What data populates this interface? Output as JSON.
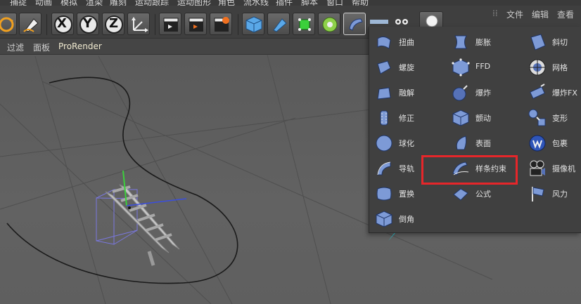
{
  "menubar": {
    "items": [
      "捕捉",
      "动画",
      "模拟",
      "渲染",
      "雕刻",
      "运动跟踪",
      "运动图形",
      "角色",
      "流水线",
      "插件",
      "脚本",
      "窗口",
      "帮助"
    ]
  },
  "toolbar": {
    "axis_x": "X",
    "axis_y": "Y",
    "axis_z": "Z"
  },
  "secondary_bar": {
    "items": [
      "过滤",
      "面板",
      "ProRender"
    ]
  },
  "right_panel": {
    "tabs": [
      "文件",
      "编辑",
      "查看"
    ]
  },
  "deformer_menu": {
    "columns": [
      [
        {
          "label": "扭曲",
          "icon": "twist-icon"
        },
        {
          "label": "螺旋",
          "icon": "helix-icon"
        },
        {
          "label": "融解",
          "icon": "melt-icon"
        },
        {
          "label": "修正",
          "icon": "correction-icon"
        },
        {
          "label": "球化",
          "icon": "spherify-icon"
        },
        {
          "label": "导轨",
          "icon": "rail-icon"
        },
        {
          "label": "置换",
          "icon": "displace-icon"
        },
        {
          "label": "倒角",
          "icon": "bevel-icon"
        }
      ],
      [
        {
          "label": "膨胀",
          "icon": "bulge-icon"
        },
        {
          "label": "FFD",
          "icon": "ffd-icon"
        },
        {
          "label": "爆炸",
          "icon": "explosion-icon"
        },
        {
          "label": "颤动",
          "icon": "jiggle-icon"
        },
        {
          "label": "表面",
          "icon": "surface-icon"
        },
        {
          "label": "样条约束",
          "icon": "spline-wrap-icon"
        },
        {
          "label": "公式",
          "icon": "formula-icon"
        }
      ],
      [
        {
          "label": "斜切",
          "icon": "shear-icon"
        },
        {
          "label": "网格",
          "icon": "mesh-icon"
        },
        {
          "label": "爆炸FX",
          "icon": "explosion-fx-icon"
        },
        {
          "label": "变形",
          "icon": "morph-icon"
        },
        {
          "label": "包裹",
          "icon": "wrap-icon"
        },
        {
          "label": "摄像机",
          "icon": "camera-icon"
        },
        {
          "label": "风力",
          "icon": "wind-icon"
        }
      ]
    ]
  },
  "colors": {
    "highlight": "#e6262a",
    "arrow": "#2bc7d4",
    "icon_blue": "#6e8fd6"
  }
}
